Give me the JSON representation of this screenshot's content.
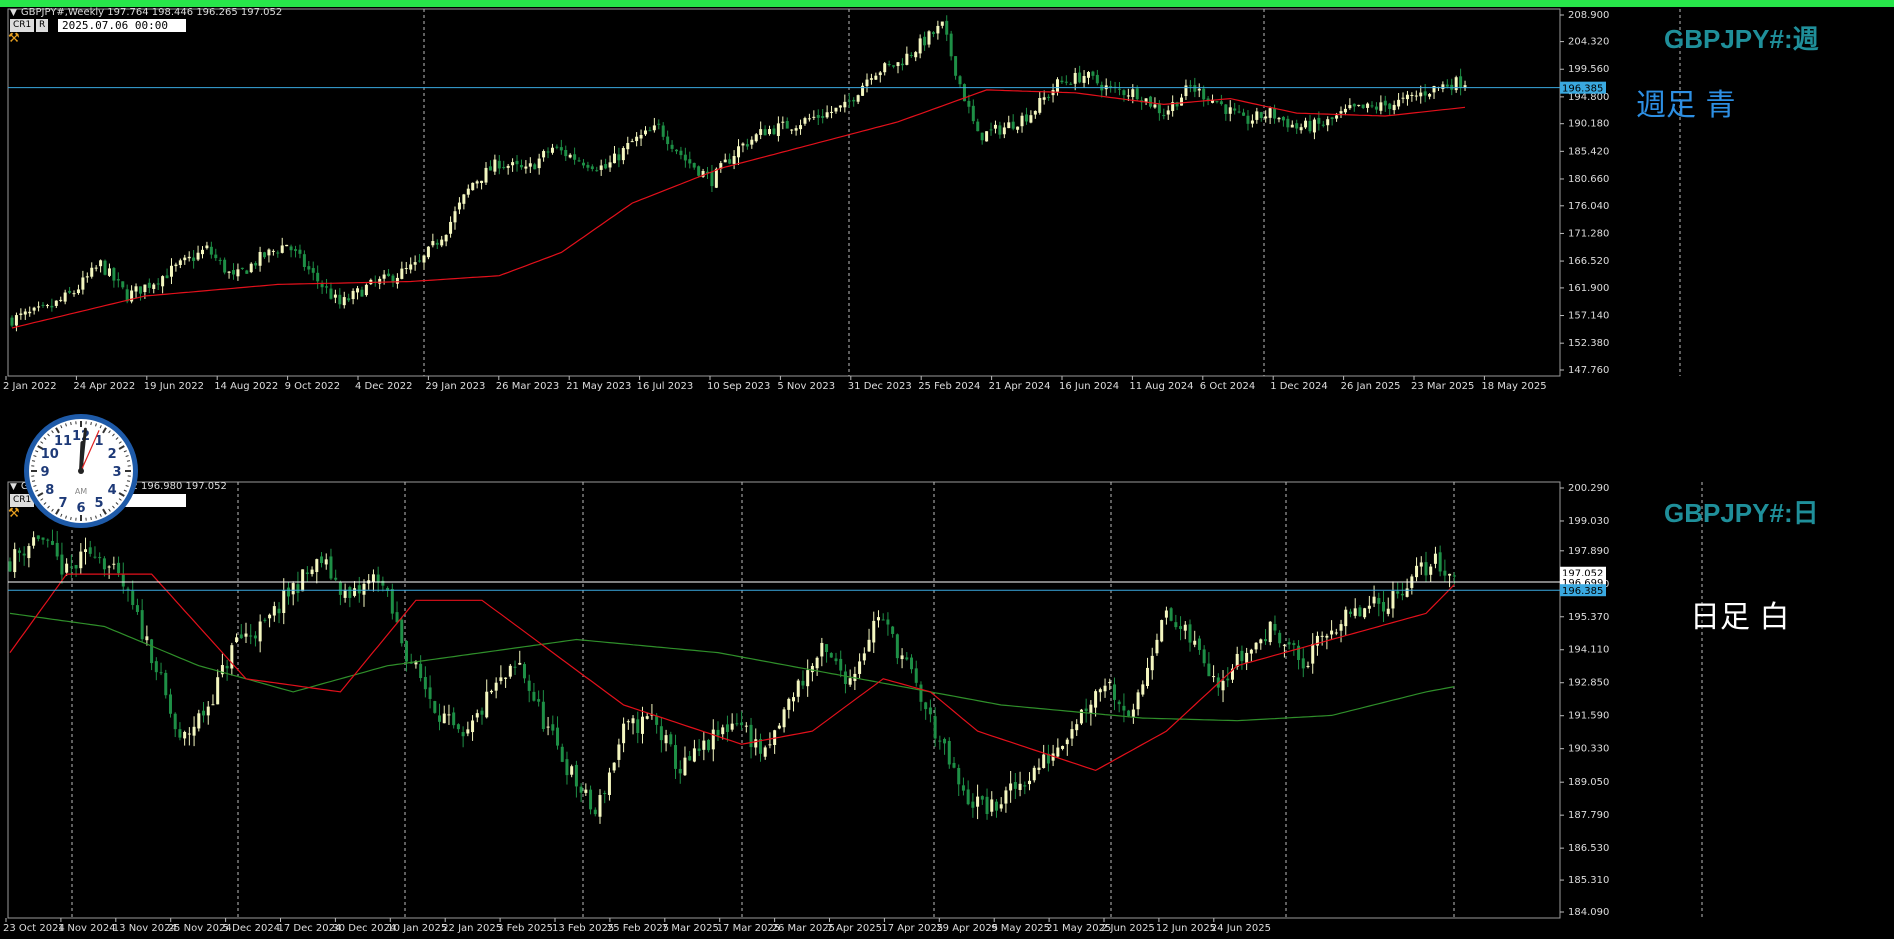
{
  "colors": {
    "background": "#000000",
    "bull": "#f4f7c0",
    "bear": "#1e8f46",
    "ma_red": "#e3101b",
    "ma_green": "#2f8f2a",
    "hline_blue": "#3aa9e0",
    "hline_white": "#ffffff",
    "title_teal": "#1f8f9a",
    "accent_green": "#27e64a"
  },
  "top_panel": {
    "info_line": "GBPJPY#,Weekly  197.764 198.446 196.265 197.052",
    "badge1": "CR1",
    "badge2": "R",
    "date": "2025.07.06 00:00",
    "symbol_title": "GBPJPY#:週",
    "note": "週足  青",
    "price_tag": "196.385",
    "icons": [
      "hammer-icon",
      "triangle-menu-icon"
    ]
  },
  "bottom_panel": {
    "info_line": "GBPJPY#,Daily  197.052 196.980 197.052",
    "badge1": "CR1",
    "date": "00:00",
    "symbol_title": "GBPJPY#:日",
    "note": "日足    白",
    "price_tag_white": "196.699",
    "price_tag_close": "197.052",
    "price_tag_blue": "196.385"
  },
  "clock": {
    "numbers": [
      "12",
      "1",
      "2",
      "3",
      "4",
      "5",
      "6",
      "7",
      "8",
      "9",
      "10",
      "11"
    ],
    "label": "AM",
    "hour": 12.1,
    "minute": 1,
    "second": 4
  },
  "chart_data": [
    {
      "type": "candlestick",
      "name": "GBPJPY# Weekly",
      "yaxis_ticks": [
        "208.900",
        "204.320",
        "199.560",
        "194.800",
        "190.180",
        "185.420",
        "180.660",
        "176.040",
        "171.280",
        "166.520",
        "161.900",
        "157.140",
        "152.380",
        "147.760"
      ],
      "ylim": [
        147.76,
        208.9
      ],
      "xaxis_ticks": [
        "2 Jan 2022",
        "24 Apr 2022",
        "19 Jun 2022",
        "14 Aug 2022",
        "9 Oct 2022",
        "4 Dec 2022",
        "29 Jan 2023",
        "26 Mar 2023",
        "21 May 2023",
        "16 Jul 2023",
        "10 Sep 2023",
        "5 Nov 2023",
        "31 Dec 2023",
        "25 Feb 2024",
        "21 Apr 2024",
        "16 Jun 2024",
        "11 Aug 2024",
        "6 Oct 2024",
        "1 Dec 2024",
        "26 Jan 2025",
        "23 Mar 2025",
        "18 May 2025"
      ],
      "hline": 196.385,
      "close_anchors": [
        [
          0,
          156.5
        ],
        [
          8,
          158.2
        ],
        [
          14,
          161.2
        ],
        [
          20,
          166.0
        ],
        [
          26,
          160.5
        ],
        [
          32,
          163.0
        ],
        [
          38,
          165.8
        ],
        [
          44,
          168.6
        ],
        [
          50,
          163.5
        ],
        [
          56,
          167.0
        ],
        [
          62,
          169.5
        ],
        [
          68,
          164.0
        ],
        [
          74,
          159.0
        ],
        [
          80,
          162.0
        ],
        [
          86,
          163.8
        ],
        [
          92,
          166.0
        ],
        [
          98,
          172.0
        ],
        [
          104,
          180.0
        ],
        [
          110,
          183.5
        ],
        [
          116,
          182.0
        ],
        [
          122,
          186.0
        ],
        [
          128,
          184.0
        ],
        [
          134,
          182.5
        ],
        [
          140,
          187.0
        ],
        [
          146,
          189.5
        ],
        [
          152,
          184.0
        ],
        [
          158,
          180.5
        ],
        [
          164,
          186.0
        ],
        [
          170,
          189.0
        ],
        [
          176,
          190.0
        ],
        [
          182,
          191.5
        ],
        [
          188,
          193.0
        ],
        [
          194,
          199.0
        ],
        [
          200,
          200.5
        ],
        [
          206,
          204.5
        ],
        [
          210,
          207.0
        ],
        [
          214,
          197.0
        ],
        [
          218,
          188.0
        ],
        [
          224,
          189.5
        ],
        [
          230,
          192.0
        ],
        [
          236,
          197.0
        ],
        [
          242,
          198.5
        ],
        [
          248,
          196.0
        ],
        [
          254,
          195.5
        ],
        [
          260,
          192.0
        ],
        [
          266,
          196.5
        ],
        [
          272,
          194.0
        ],
        [
          278,
          190.5
        ],
        [
          284,
          192.0
        ],
        [
          290,
          189.5
        ],
        [
          296,
          190.0
        ],
        [
          302,
          192.5
        ],
        [
          308,
          193.0
        ],
        [
          314,
          194.0
        ],
        [
          320,
          196.0
        ],
        [
          324,
          197.0
        ],
        [
          328,
          197.5
        ]
      ],
      "ma_red_anchors": [
        [
          0,
          155.0
        ],
        [
          30,
          160.5
        ],
        [
          60,
          162.5
        ],
        [
          90,
          163.0
        ],
        [
          110,
          164.0
        ],
        [
          124,
          168.0
        ],
        [
          140,
          176.5
        ],
        [
          160,
          182.5
        ],
        [
          180,
          186.5
        ],
        [
          200,
          190.5
        ],
        [
          220,
          196.0
        ],
        [
          240,
          195.5
        ],
        [
          260,
          193.5
        ],
        [
          275,
          194.5
        ],
        [
          290,
          192.0
        ],
        [
          310,
          191.5
        ],
        [
          328,
          193.0
        ]
      ]
    },
    {
      "type": "candlestick",
      "name": "GBPJPY# Daily",
      "yaxis_ticks": [
        "200.290",
        "199.030",
        "197.890",
        "196.630",
        "195.370",
        "194.110",
        "192.850",
        "191.590",
        "190.330",
        "189.050",
        "187.790",
        "186.530",
        "185.310",
        "184.090"
      ],
      "ylim": [
        184.09,
        200.29
      ],
      "xaxis_ticks": [
        "23 Oct 2024",
        "1 Nov 2024",
        "13 Nov 2024",
        "25 Nov 2024",
        "5 Dec 2024",
        "17 Dec 2024",
        "30 Dec 2024",
        "10 Jan 2025",
        "22 Jan 2025",
        "3 Feb 2025",
        "13 Feb 2025",
        "25 Feb 2025",
        "7 Mar 2025",
        "17 Mar 2025",
        "26 Mar 2025",
        "7 Apr 2025",
        "17 Apr 2025",
        "29 Apr 2025",
        "9 May 2025",
        "21 May 2025",
        "2 Jun 2025",
        "12 Jun 2025",
        "24 Jun 2025"
      ],
      "hline_white": 196.699,
      "hline_blue": 196.385,
      "close_anchors": [
        [
          0,
          197.5
        ],
        [
          6,
          198.5
        ],
        [
          12,
          197.0
        ],
        [
          18,
          198.0
        ],
        [
          24,
          196.5
        ],
        [
          30,
          194.0
        ],
        [
          36,
          190.5
        ],
        [
          42,
          192.0
        ],
        [
          48,
          194.5
        ],
        [
          54,
          195.0
        ],
        [
          60,
          196.5
        ],
        [
          66,
          197.5
        ],
        [
          72,
          196.0
        ],
        [
          78,
          197.0
        ],
        [
          84,
          194.0
        ],
        [
          90,
          192.0
        ],
        [
          96,
          190.5
        ],
        [
          102,
          192.5
        ],
        [
          108,
          193.5
        ],
        [
          114,
          191.0
        ],
        [
          120,
          189.0
        ],
        [
          124,
          187.8
        ],
        [
          130,
          191.0
        ],
        [
          136,
          191.5
        ],
        [
          142,
          189.5
        ],
        [
          148,
          190.5
        ],
        [
          154,
          191.5
        ],
        [
          160,
          190.0
        ],
        [
          166,
          192.5
        ],
        [
          172,
          194.0
        ],
        [
          178,
          193.0
        ],
        [
          184,
          195.5
        ],
        [
          190,
          193.5
        ],
        [
          196,
          191.0
        ],
        [
          202,
          188.5
        ],
        [
          208,
          188.0
        ],
        [
          214,
          189.0
        ],
        [
          220,
          190.0
        ],
        [
          226,
          191.5
        ],
        [
          232,
          193.0
        ],
        [
          238,
          191.5
        ],
        [
          244,
          195.5
        ],
        [
          250,
          194.5
        ],
        [
          256,
          193.0
        ],
        [
          262,
          194.0
        ],
        [
          268,
          195.0
        ],
        [
          274,
          193.5
        ],
        [
          280,
          195.0
        ],
        [
          286,
          195.5
        ],
        [
          292,
          196.0
        ],
        [
          298,
          197.0
        ],
        [
          302,
          197.5
        ],
        [
          306,
          196.9
        ]
      ],
      "ma_red_anchors": [
        [
          0,
          194.0
        ],
        [
          12,
          197.0
        ],
        [
          30,
          197.0
        ],
        [
          50,
          193.0
        ],
        [
          70,
          192.5
        ],
        [
          86,
          196.0
        ],
        [
          100,
          196.0
        ],
        [
          115,
          194.0
        ],
        [
          130,
          192.0
        ],
        [
          155,
          190.5
        ],
        [
          170,
          191.0
        ],
        [
          185,
          193.0
        ],
        [
          195,
          192.5
        ],
        [
          205,
          191.0
        ],
        [
          230,
          189.5
        ],
        [
          245,
          191.0
        ],
        [
          260,
          193.5
        ],
        [
          280,
          194.5
        ],
        [
          300,
          195.5
        ],
        [
          306,
          196.6
        ]
      ],
      "ma_green_anchors": [
        [
          0,
          195.5
        ],
        [
          20,
          195.0
        ],
        [
          40,
          193.5
        ],
        [
          60,
          192.5
        ],
        [
          80,
          193.5
        ],
        [
          100,
          194.0
        ],
        [
          120,
          194.5
        ],
        [
          150,
          194.0
        ],
        [
          180,
          193.0
        ],
        [
          210,
          192.0
        ],
        [
          240,
          191.5
        ],
        [
          260,
          191.4
        ],
        [
          280,
          191.6
        ],
        [
          300,
          192.5
        ],
        [
          306,
          192.7
        ]
      ]
    }
  ]
}
